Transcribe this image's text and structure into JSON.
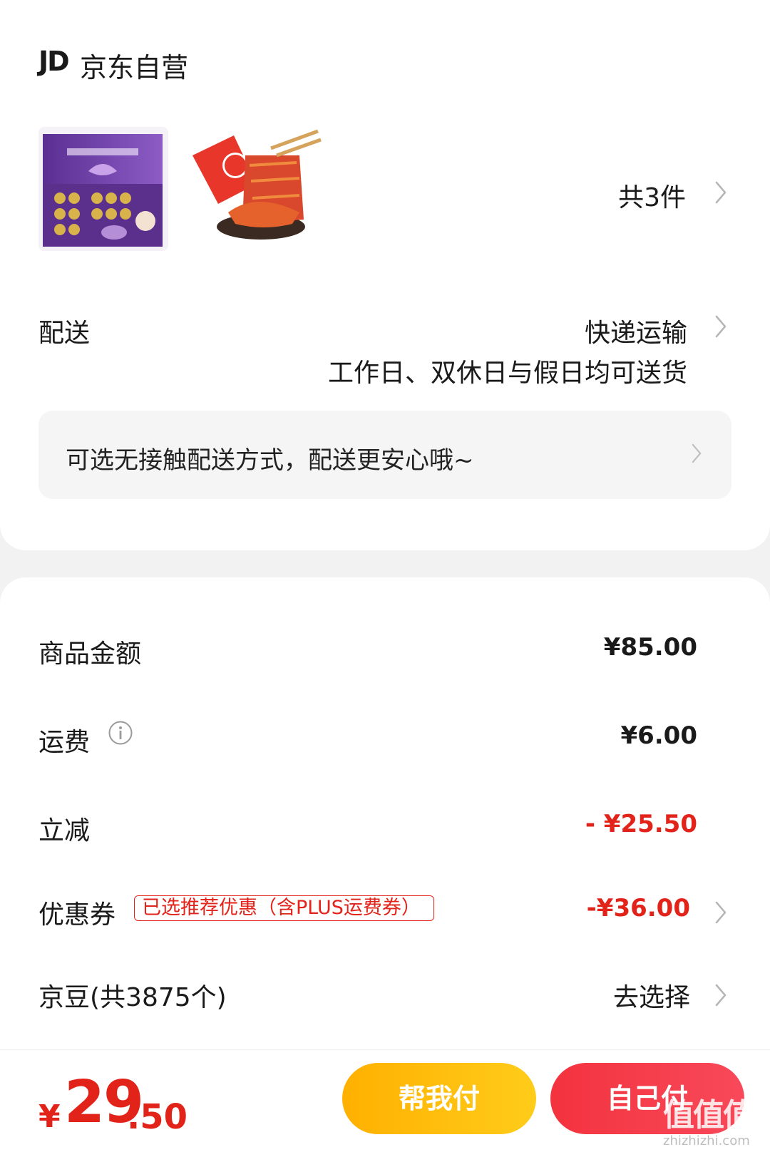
{
  "shop": {
    "logo": "JD",
    "name": "京东自营"
  },
  "items": {
    "count_label": "共3件",
    "thumbnails": [
      "purple-gift-box-image",
      "spicy-snack-pack-image"
    ]
  },
  "delivery": {
    "label": "配送",
    "method": "快递运输",
    "note": "工作日、双休日与假日均可送货",
    "contactless_text": "可选无接触配送方式，配送更安心哦~"
  },
  "fees": {
    "goods_label": "商品金额",
    "goods_value": "¥85.00",
    "shipping_label": "运费",
    "shipping_value": "¥6.00",
    "discount_label": "立减",
    "discount_value": "- ¥25.50",
    "coupon_label": "优惠券",
    "coupon_tag": "已选推荐优惠（含PLUS运费券）",
    "coupon_value": "-¥36.00",
    "beans_label": "京豆(共3875个)",
    "beans_action": "去选择"
  },
  "footer": {
    "currency": "¥",
    "total_int": "29",
    "total_dec": ".50",
    "help_pay_label": "帮我付",
    "self_pay_label": "自己付"
  },
  "watermark": {
    "text": "值值值",
    "sub": "zhizhizhi.com"
  },
  "colors": {
    "accent_red": "#e2231a",
    "help_pay": "#ffb000",
    "self_pay": "#f3333e"
  }
}
